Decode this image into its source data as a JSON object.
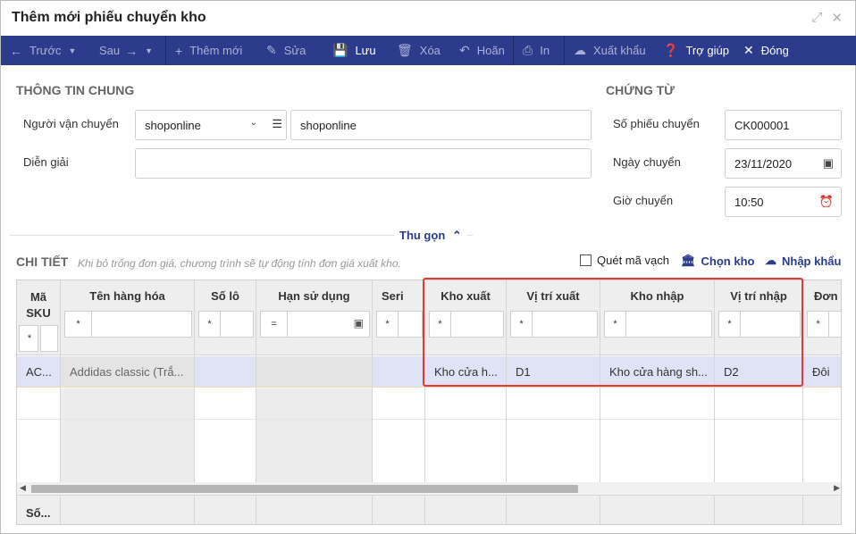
{
  "dialog": {
    "title": "Thêm mới phiếu chuyển kho",
    "expand_icon": "expand-icon",
    "close_icon": "close-icon"
  },
  "toolbar": {
    "prev": "Trước",
    "next": "Sau",
    "add": "Thêm mới",
    "edit": "Sửa",
    "save": "Lưu",
    "delete": "Xóa",
    "undo": "Hoãn",
    "print": "In",
    "export": "Xuất khẩu",
    "help": "Trợ giúp",
    "close": "Đóng"
  },
  "general": {
    "section_title": "THÔNG TIN CHUNG",
    "shipper_label": "Người vận chuyển",
    "shipper_value": "shoponline",
    "shipper_name": "shoponline",
    "description_label": "Diễn giải",
    "description_value": ""
  },
  "voucher": {
    "section_title": "CHỨNG TỪ",
    "number_label": "Số phiếu chuyển",
    "number_value": "CK000001",
    "date_label": "Ngày chuyển",
    "date_value": "23/11/2020",
    "time_label": "Giờ chuyển",
    "time_value": "10:50"
  },
  "collapse_label": "Thu gọn",
  "detail": {
    "section_title": "CHI TIẾT",
    "note": "Khi bỏ trống đơn giá, chương trình sẽ tự động tính đơn giá xuất kho.",
    "scan_barcode": "Quét mã vạch",
    "choose_warehouse": "Chọn kho",
    "import": "Nhập khẩu"
  },
  "grid": {
    "columns": [
      {
        "label": "Mã SKU",
        "filter_op": "*",
        "cell": "AC..."
      },
      {
        "label": "Tên hàng hóa",
        "filter_op": "*",
        "cell": "Addidas classic (Trắ..."
      },
      {
        "label": "Số lô",
        "filter_op": "*",
        "cell": ""
      },
      {
        "label": "Hạn sử dụng",
        "filter_op": "=",
        "cell": ""
      },
      {
        "label": "Seri",
        "filter_op": "*",
        "cell": ""
      },
      {
        "label": "Kho xuất",
        "filter_op": "*",
        "cell": "Kho cửa h..."
      },
      {
        "label": "Vị trí xuất",
        "filter_op": "*",
        "cell": "D1"
      },
      {
        "label": "Kho nhập",
        "filter_op": "*",
        "cell": "Kho cửa hàng sh..."
      },
      {
        "label": "Vị trí nhập",
        "filter_op": "*",
        "cell": "D2"
      },
      {
        "label": "Đơn v",
        "filter_op": "*",
        "cell": "Đôi"
      }
    ],
    "footer_first": "Số..."
  }
}
